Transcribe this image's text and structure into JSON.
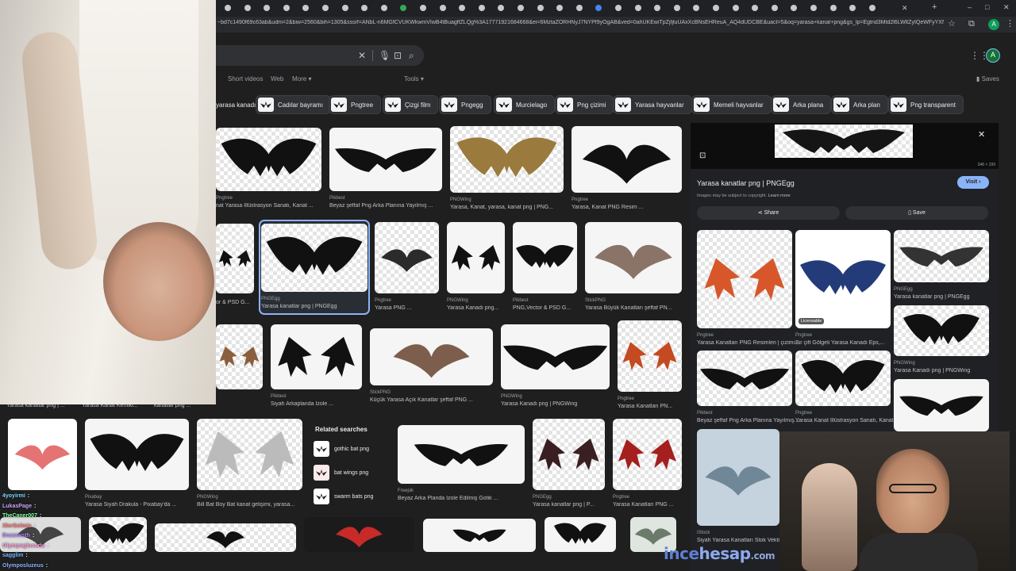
{
  "browser": {
    "url": "~bd7c1490f69c63ab&udm=2&biw=2560&bih=1305&sssrf=ANbL-n6MGfCVUKWkwmVIwB4tBuagffZLQg%3A17771921684668&ei=6MztaZORHNyJ7NYPf9yOgAB&ved=0ahUKEwiTpZjfjluUAxXcBNsEHReuA_AQ4dUDCBE&uact=5&oq=yarasa+kanat+png&gs_lp=Egtnd3Mtd2l6LWltZyIQeWFyYXNh",
    "avatar_letter": "A",
    "window_controls": [
      "–",
      "□",
      "✕"
    ]
  },
  "google": {
    "nav_tabs": [
      "Short videos",
      "Web",
      "More",
      "Tools"
    ],
    "saves_label": "Saves",
    "account_letter": "A",
    "chips": [
      "yarasa kanadı",
      "Cadılar bayramı",
      "Pngtree",
      "Çizgi film",
      "Pngegg",
      "Murcielago",
      "Png çizimi",
      "Yarasa hayvanlar",
      "Memeli hayvanlar",
      "Arka plana",
      "Arka plan",
      "Png transparent"
    ],
    "row1": [
      {
        "src": "Pngtree",
        "cap": "nat Yarasa İllüstrasyon Sanatı, Kanat ..."
      },
      {
        "src": "Pikbest",
        "cap": "Beyaz şeffaf Png Arka Planına Yayılmış ..."
      },
      {
        "src": "PNGWing",
        "cap": "Yarasa, Kanat, yarasa, kanat png | PNG..."
      },
      {
        "src": "Pngtree",
        "cap": "Yarasa, Kanat PNG Resim ..."
      }
    ],
    "row2": [
      {
        "src": "",
        "cap": "or & PSD G..."
      },
      {
        "src": "PNGEgg",
        "cap": "Yarasa kanatlar png | PNGEgg"
      },
      {
        "src": "Pngtree",
        "cap": "Yarasa PNG ..."
      },
      {
        "src": "PNGWing",
        "cap": "Yarasa Kanadı png..."
      },
      {
        "src": "Pikbest",
        "cap": "PNG,Vector & PSD G..."
      },
      {
        "src": "StickPNG",
        "cap": "Yarasa Büyük Kanatları şeffaf PN..."
      }
    ],
    "row3": [
      {
        "src": "Pikbest",
        "cap": "Siyah Arkaplanda İzole ..."
      },
      {
        "src": "StickPNG",
        "cap": "Küçük Yarasa Açık Kanatlar şeffaf PNG ..."
      },
      {
        "src": "PNGWing",
        "cap": "Yarasa Kanadı png | PNGWing"
      },
      {
        "src": "Pngtree",
        "cap": "Yarasa Kanatları PN..."
      }
    ],
    "row3_left_caps": [
      "Yarasa kanatlar png | ...",
      "Yarasa Kanat Kemiki...",
      "kanatlar png ..."
    ],
    "row4": [
      {
        "src": "Pixabay",
        "cap": "Yarasa Siyah Drakula - Pixabay'da ..."
      },
      {
        "src": "PNGWing",
        "cap": "Bill Bat Boy Bat kanat gelişimi, yarasa..."
      },
      {
        "src": "Freepik",
        "cap": "Beyaz Arka Planda İzole Edilmiş Gotik ..."
      },
      {
        "src": "PNGEgg",
        "cap": "Yarasa kanatlar png | P..."
      },
      {
        "src": "Pngtree",
        "cap": "Yarasa Kanatları PNG ..."
      }
    ],
    "related": {
      "title": "Related searches",
      "items": [
        "gothic bat png",
        "bat wings png",
        "swarm bats png"
      ]
    }
  },
  "panel": {
    "dims": "348 × 199",
    "title": "Yarasa kanatlar png | PNGEgg",
    "visit": "Visit",
    "copyright": "Images may be subject to copyright.",
    "learn_more": "Learn more",
    "share": "Share",
    "save": "Save",
    "licensable": "Licensable",
    "related": [
      {
        "src": "Pngtree",
        "cap": "Yarasa Kanatları PNG Resimleri | çizimi..."
      },
      {
        "src": "Pngtree",
        "cap": "Bir çift Gölgeli Yarasa Kanadı Eps,..."
      },
      {
        "src": "PNGEgg",
        "cap": "Yarasa kanatlar png | PNGEgg"
      },
      {
        "src": "PNGWing",
        "cap": "Yarasa Kanadı png | PNGWing"
      },
      {
        "src": "Pikbest",
        "cap": "Beyaz şeffaf Png Arka Planına Yayılmış..."
      },
      {
        "src": "Pngtree",
        "cap": "Yarasa Kanat İllüstrasyon Sanatı, Kanat..."
      },
      {
        "src": "iStock",
        "cap": "Siyah Yarasa Kanatları Stok Vektör S..."
      }
    ]
  },
  "chat": [
    {
      "user": "4yoyirmi",
      "msg": ":",
      "color": "#7fd6ff"
    },
    {
      "user": "LukasPage",
      "msg": ":",
      "color": "#c7a6ff"
    },
    {
      "user": "TheCaner007",
      "msg": ":",
      "color": "#7dff9a"
    },
    {
      "user": "XlerGelmis",
      "msg": ":",
      "color": "#ff7a7a"
    },
    {
      "user": "Dozzmisth",
      "msg": ":",
      "color": "#b48cff"
    },
    {
      "user": "Olympoglusudu",
      "msg": ":",
      "color": "#ff9ad9"
    },
    {
      "user": "sagglim",
      "msg": ":",
      "color": "#7ab8ff"
    },
    {
      "user": "Olymposluzeus",
      "msg": ":",
      "color": "#8fb4ff"
    }
  ],
  "watermark": {
    "a": "ince",
    "b": "hesap",
    "c": ".com"
  }
}
